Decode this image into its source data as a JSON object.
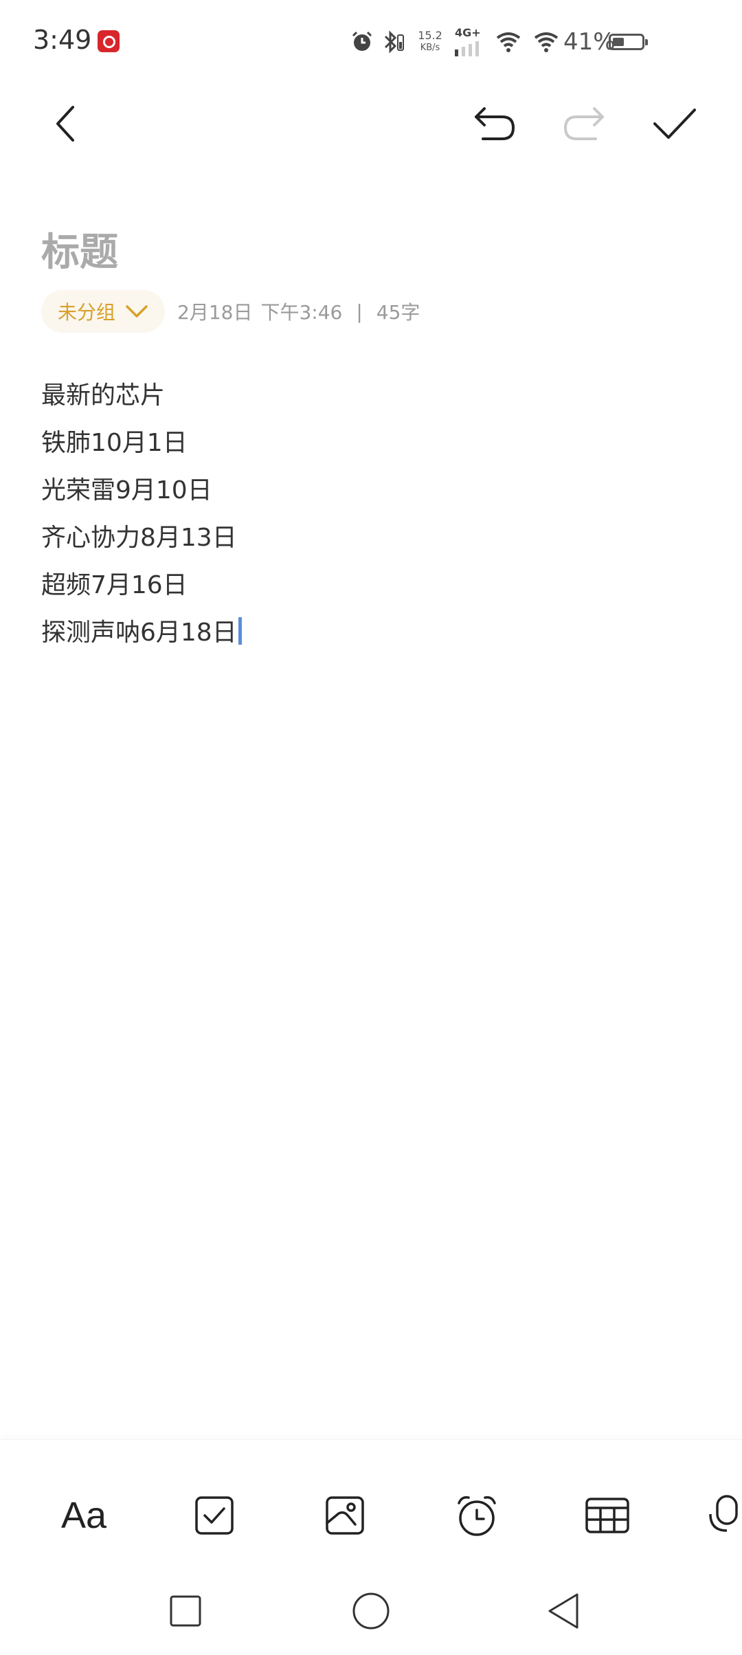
{
  "status_bar": {
    "time": "3:49",
    "net_speed_value": "15.2",
    "net_speed_unit": "KB/s",
    "network_type": "4G+",
    "battery_percent": "41%",
    "battery_level": 0.41,
    "icons": [
      "netease-music-icon",
      "alarm-icon",
      "bluetooth-icon",
      "signal-icon",
      "wifi-icon",
      "battery-icon"
    ]
  },
  "top_toolbar": {
    "back": "back-icon",
    "undo": "undo-icon",
    "redo": "redo-icon",
    "done": "checkmark-icon"
  },
  "note": {
    "title_placeholder": "标题",
    "group_label": "未分组",
    "date": "2月18日",
    "time": "下午3:46",
    "separator": "|",
    "char_count": "45字",
    "lines": [
      "最新的芯片",
      "铁肺10月1日",
      "光荣雷9月10日",
      "齐心协力8月13日",
      "超频7月16日",
      "探测声呐6月18日"
    ]
  },
  "bottom_toolbar": {
    "font_label": "Aa",
    "tools": [
      "font-style",
      "checklist",
      "image",
      "reminder",
      "table",
      "voice"
    ]
  },
  "nav_bar": {
    "buttons": [
      "recents",
      "home",
      "back"
    ]
  },
  "colors": {
    "accent": "#d7a12a",
    "chip_bg": "#fbf6ee",
    "cursor": "#5b8dd8",
    "text": "#333333",
    "placeholder": "#aaaaaa"
  }
}
